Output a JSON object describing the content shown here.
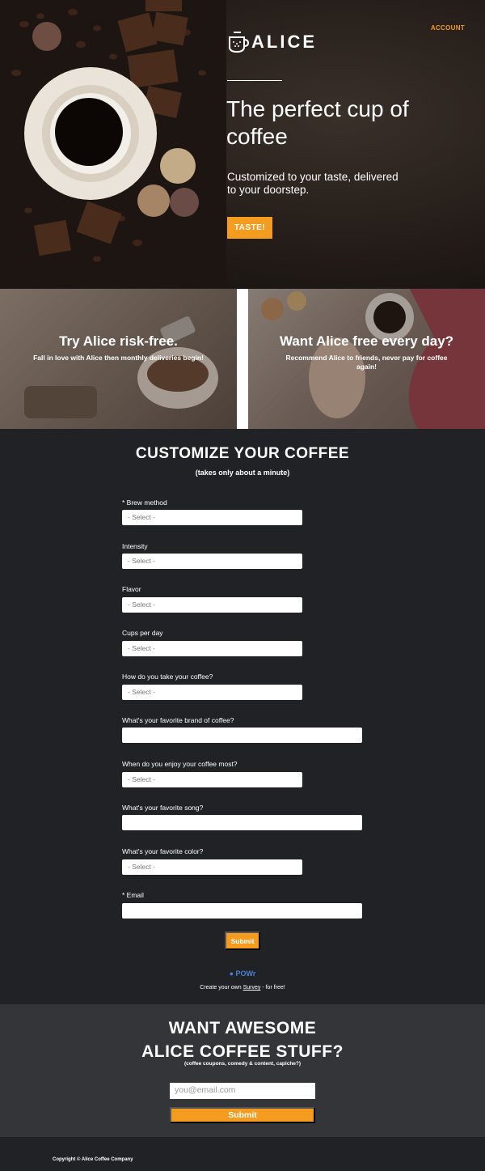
{
  "hero": {
    "account_label": "ACCOUNT",
    "logo_text": "ALICE",
    "title": "The perfect cup of coffee",
    "subtitle": "Customized to your taste, delivered to your doorstep.",
    "cta_label": "TASTE!"
  },
  "panels": [
    {
      "title": "Try Alice risk-free.",
      "text": "Fall in love with Alice then monthly deliveries begin!"
    },
    {
      "title": "Want Alice free every day?",
      "text": "Recommend Alice to friends, never pay for coffee again!"
    }
  ],
  "form": {
    "title": "CUSTOMIZE YOUR COFFEE",
    "subtitle": "(takes only about a minute)",
    "fields": [
      {
        "label": "* Brew method",
        "type": "select",
        "value": "- Select -"
      },
      {
        "label": "Intensity",
        "type": "select",
        "value": "- Select -"
      },
      {
        "label": "Flavor",
        "type": "select",
        "value": "- Select -"
      },
      {
        "label": "Cups per day",
        "type": "select",
        "value": "- Select -"
      },
      {
        "label": "How do you take your coffee?",
        "type": "select",
        "value": "- Select -"
      },
      {
        "label": "What's your favorite brand of coffee?",
        "type": "text",
        "value": ""
      },
      {
        "label": "When do you enjoy your coffee most?",
        "type": "select",
        "value": "- Select -"
      },
      {
        "label": "What's your favorite song?",
        "type": "text",
        "value": ""
      },
      {
        "label": "What's your favorite color?",
        "type": "select",
        "value": "- Select -"
      },
      {
        "label": "* Email",
        "type": "text",
        "value": ""
      }
    ],
    "submit_label": "Submit",
    "powr_label": "POWr",
    "powr_note_prefix": "Create your own",
    "powr_note_link": "Survey",
    "powr_note_suffix": "- for free!"
  },
  "newsletter": {
    "title_line1": "WANT AWESOME",
    "title_line2": "ALICE COFFEE STUFF?",
    "subtitle": "(coffee coupons, comedy & content, capiche?)",
    "email_placeholder": "you@email.com",
    "submit_label": "Submit"
  },
  "footer": {
    "copyright": "Copyright © Alice Coffee Company"
  },
  "colors": {
    "accent": "#f39c1f",
    "dark_bg": "#202226",
    "newsletter_bg": "#343538",
    "powr_blue": "#4a7fd6"
  }
}
